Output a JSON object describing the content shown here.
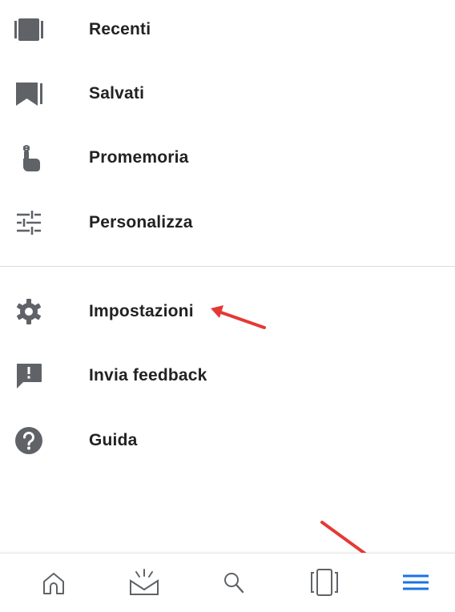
{
  "menu": {
    "items": [
      {
        "label": "Recenti",
        "icon": "recent-stack-icon"
      },
      {
        "label": "Salvati",
        "icon": "bookmark-icon"
      },
      {
        "label": "Promemoria",
        "icon": "reminder-finger-icon"
      },
      {
        "label": "Personalizza",
        "icon": "sliders-icon"
      },
      {
        "label": "Impostazioni",
        "icon": "gear-icon"
      },
      {
        "label": "Invia feedback",
        "icon": "feedback-icon"
      },
      {
        "label": "Guida",
        "icon": "help-icon"
      }
    ]
  },
  "bottom_nav": {
    "tabs": [
      {
        "icon": "home-icon"
      },
      {
        "icon": "updates-icon"
      },
      {
        "icon": "search-icon"
      },
      {
        "icon": "recent-apps-icon"
      },
      {
        "icon": "menu-icon",
        "active": true
      }
    ]
  },
  "colors": {
    "icon_gray": "#5f6368",
    "active_blue": "#1a73e8",
    "annotation_red": "#e53935",
    "text": "#222222"
  }
}
